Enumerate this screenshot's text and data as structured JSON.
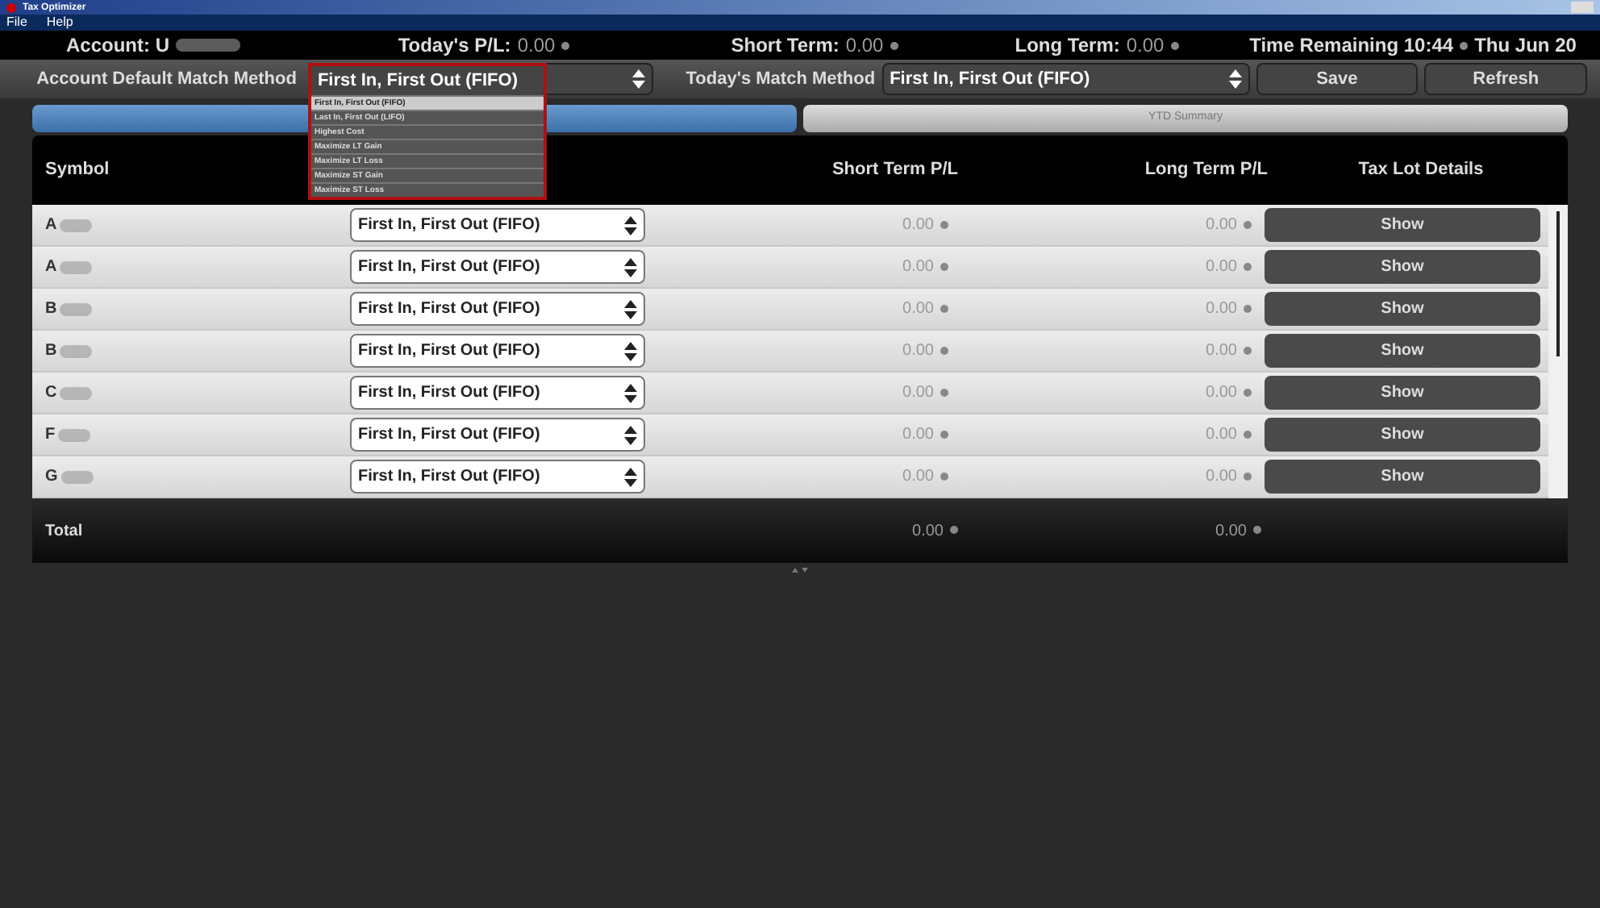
{
  "window": {
    "title": "Tax Optimizer"
  },
  "menu": [
    "File",
    "Help"
  ],
  "summary": {
    "account_label": "Account:",
    "account": "U",
    "todays_pl_label": "Today's P/L:",
    "todays_pl": "0.00",
    "short_term_label": "Short Term:",
    "short_term": "0.00",
    "long_term_label": "Long Term:",
    "long_term": "0.00",
    "time_remaining": "Time Remaining 10:44",
    "date": "Thu Jun 20"
  },
  "default_method": {
    "label": "Account Default Match Method",
    "value": "First In, First Out (FIFO)",
    "expanded": true,
    "options": [
      {
        "label": "First In, First Out (FIFO)",
        "selected": true
      },
      {
        "label": "Last In, First Out (LIFO)",
        "selected": false
      },
      {
        "label": "Highest Cost",
        "selected": false
      },
      {
        "label": "Maximize LT Gain",
        "selected": false
      },
      {
        "label": "Maximize LT Loss",
        "selected": false
      },
      {
        "label": "Maximize ST Gain",
        "selected": false
      },
      {
        "label": "Maximize ST Loss",
        "selected": false
      }
    ]
  },
  "todays_method": {
    "label": "Today's Match Method",
    "value": "First In, First Out (FIFO)"
  },
  "buttons": [
    "Save",
    "Refresh"
  ],
  "tabs": [
    {
      "selected": true
    },
    {
      "label": "YTD Summary",
      "selected": false
    }
  ],
  "table": {
    "columns": [
      "Symbol",
      "Short Term P/L",
      "Long Term P/L",
      "Tax Lot Details"
    ],
    "rows": [
      {
        "symbol": "A",
        "method": "First In, First Out (FIFO)",
        "short_term": "0.00",
        "long_term": "0.00",
        "action": "Show"
      },
      {
        "symbol": "A",
        "method": "First In, First Out (FIFO)",
        "short_term": "0.00",
        "long_term": "0.00",
        "action": "Show"
      },
      {
        "symbol": "B",
        "method": "First In, First Out (FIFO)",
        "short_term": "0.00",
        "long_term": "0.00",
        "action": "Show"
      },
      {
        "symbol": "B",
        "method": "First In, First Out (FIFO)",
        "short_term": "0.00",
        "long_term": "0.00",
        "action": "Show"
      },
      {
        "symbol": "C",
        "method": "First In, First Out (FIFO)",
        "short_term": "0.00",
        "long_term": "0.00",
        "action": "Show"
      },
      {
        "symbol": "F",
        "method": "First In, First Out (FIFO)",
        "short_term": "0.00",
        "long_term": "0.00",
        "action": "Show"
      },
      {
        "symbol": "G",
        "method": "First In, First Out (FIFO)",
        "short_term": "0.00",
        "long_term": "0.00",
        "action": "Show"
      }
    ],
    "total": {
      "label": "Total",
      "short_term": "0.00",
      "long_term": "0.00"
    }
  }
}
